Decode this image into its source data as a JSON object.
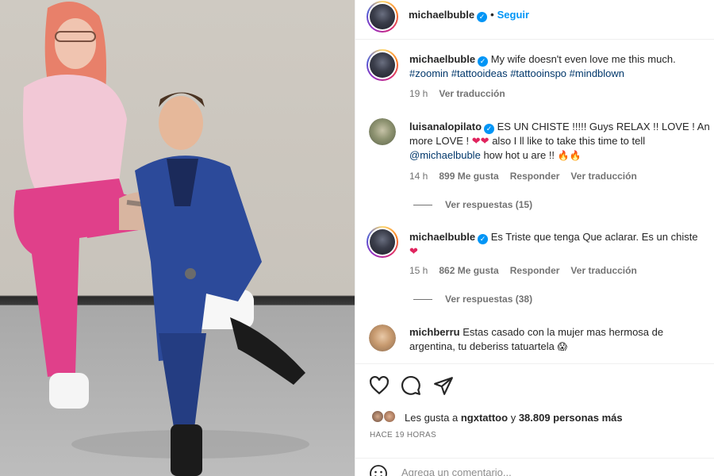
{
  "post": {
    "author": "michaelbuble",
    "follow_label": "Seguir",
    "separator": "•"
  },
  "caption": {
    "username": "michaelbuble",
    "text": "My wife doesn't even love me this much.",
    "hashtags": "#zoomin #tattooideas #tattooinspo #mindblown",
    "time": "19 h",
    "translate": "Ver traducción"
  },
  "comments": [
    {
      "username": "luisanalopilato",
      "text_line1": "ES UN CHISTE !!!!! Guys RELAX !! LOVE ! An",
      "text_line2a": "more LOVE !",
      "text_line2b": "also I ll like to take this time to tell",
      "mention": "@michaelbuble",
      "text_line3": "how hot u are !!",
      "time": "14 h",
      "likes": "899 Me gusta",
      "reply": "Responder",
      "translate": "Ver traducción",
      "view_replies": "Ver respuestas (15)"
    },
    {
      "username": "michaelbuble",
      "text_line1": "Es Triste que tenga Que aclarar. Es un chiste",
      "time": "15 h",
      "likes": "862 Me gusta",
      "reply": "Responder",
      "translate": "Ver traducción",
      "view_replies": "Ver respuestas (38)"
    },
    {
      "username": "michberru",
      "text_line1": "Estas casado con la mujer mas hermosa de",
      "text_line2": "argentina, tu deberiss tatuartela"
    }
  ],
  "engagement": {
    "likes_prefix": "Les gusta a",
    "likes_user": "ngxtattoo",
    "likes_conj": "y",
    "likes_count": "38.809 personas más",
    "time_ago": "HACE 19 HORAS"
  },
  "composer": {
    "placeholder": "Agrega un comentario..."
  },
  "icons": {
    "like": "heart-outline-icon",
    "comment": "comment-icon",
    "share": "share-icon",
    "verified": "verified-badge-icon",
    "emoji": "emoji-icon"
  },
  "colors": {
    "link_blue": "#0095f6",
    "hashtag": "#00376b",
    "heart_red": "#e0245e",
    "muted": "#737373"
  }
}
